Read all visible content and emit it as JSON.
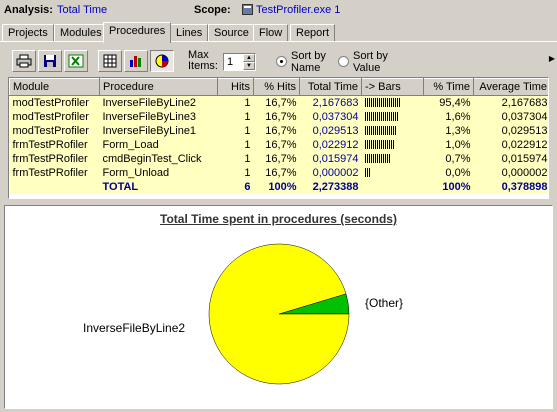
{
  "header": {
    "analysis_label": "Analysis:",
    "analysis_value": "Total Time",
    "scope_label": "Scope:",
    "scope_value": "TestProfiler.exe 1"
  },
  "tabs": [
    {
      "label": "Projects",
      "active": false
    },
    {
      "label": "Modules",
      "active": false
    },
    {
      "label": "Procedures",
      "active": true
    },
    {
      "label": "Lines",
      "active": false
    },
    {
      "label": "Source",
      "active": false
    },
    {
      "label": "Flow",
      "active": false
    },
    {
      "label": "Report",
      "active": false
    }
  ],
  "toolbar": {
    "buttons": [
      "print-icon",
      "save-icon",
      "export-excel-icon",
      "table-view-icon",
      "bar-chart-icon",
      "pie-chart-icon"
    ],
    "max_items_label_1": "Max",
    "max_items_label_2": "Items:",
    "max_items_value": "1",
    "sort_by_name_1": "Sort by",
    "sort_by_name_2": "Name",
    "sort_by_value_1": "Sort by",
    "sort_by_value_2": "Value",
    "sort_selected": "name"
  },
  "table": {
    "columns": [
      "Module",
      "Procedure",
      "Hits",
      "% Hits",
      "Total Time",
      "-> Bars",
      "% Time",
      "Average Time"
    ],
    "rows": [
      {
        "module": "modTestProfiler",
        "procedure": "InverseFileByLine2",
        "hits": "1",
        "pct_hits": "16,7%",
        "total_time": "2,167683",
        "bars": 18,
        "pct_time": "95,4%",
        "avg_time": "2,167683"
      },
      {
        "module": "modTestProfiler",
        "procedure": "InverseFileByLine3",
        "hits": "1",
        "pct_hits": "16,7%",
        "total_time": "0,037304",
        "bars": 17,
        "pct_time": "1,6%",
        "avg_time": "0,037304"
      },
      {
        "module": "modTestProfiler",
        "procedure": "InverseFileByLine1",
        "hits": "1",
        "pct_hits": "16,7%",
        "total_time": "0,029513",
        "bars": 16,
        "pct_time": "1,3%",
        "avg_time": "0,029513"
      },
      {
        "module": "frmTestPRofiler",
        "procedure": "Form_Load",
        "hits": "1",
        "pct_hits": "16,7%",
        "total_time": "0,022912",
        "bars": 15,
        "pct_time": "1,0%",
        "avg_time": "0,022912"
      },
      {
        "module": "frmTestPRofiler",
        "procedure": "cmdBeginTest_Click",
        "hits": "1",
        "pct_hits": "16,7%",
        "total_time": "0,015974",
        "bars": 13,
        "pct_time": "0,7%",
        "avg_time": "0,015974"
      },
      {
        "module": "frmTestPRofiler",
        "procedure": "Form_Unload",
        "hits": "1",
        "pct_hits": "16,7%",
        "total_time": "0,000002",
        "bars": 3,
        "pct_time": "0,0%",
        "avg_time": "0,000002"
      }
    ],
    "total": {
      "module": "",
      "procedure": "TOTAL",
      "hits": "6",
      "pct_hits": "100%",
      "total_time": "2,273388",
      "bars": 0,
      "pct_time": "100%",
      "avg_time": "0,378898"
    }
  },
  "chart_data": {
    "type": "pie",
    "title": "Total Time spent in procedures (seconds)",
    "slices": [
      {
        "label": "InverseFileByLine2",
        "value": 2.167683,
        "color": "#ffff00"
      },
      {
        "label": "{Other}",
        "value": 0.105705,
        "color": "#00c000"
      }
    ]
  }
}
